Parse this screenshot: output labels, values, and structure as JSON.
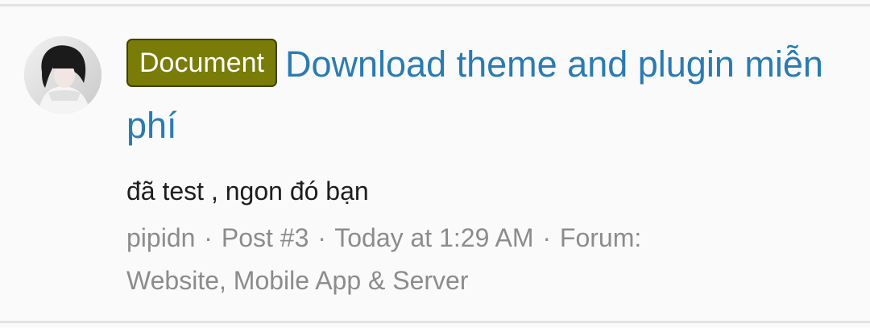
{
  "result": {
    "prefix": "Document",
    "title": "Download theme and plugin miễn phí",
    "snippet": "đã test , ngon đó bạn",
    "meta": {
      "author": "pipidn",
      "post": "Post #3",
      "time": "Today at 1:29 AM",
      "forum_label": "Forum:",
      "forum": "Website, Mobile App & Server",
      "separator": "·"
    }
  },
  "colors": {
    "title": "#2b7bb1",
    "badge_bg": "#7a7c08",
    "meta": "#8c8c8c"
  }
}
